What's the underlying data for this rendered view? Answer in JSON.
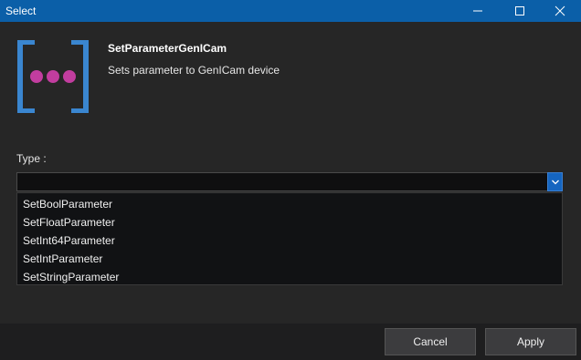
{
  "window": {
    "title": "Select",
    "controls": [
      {
        "name": "minimize-icon"
      },
      {
        "name": "maximize-icon"
      },
      {
        "name": "close-icon"
      }
    ]
  },
  "header": {
    "name": "SetParameterGenICam",
    "description": "Sets parameter to GenICam device",
    "logo_colors": {
      "bracket": "#3a86d0",
      "dots": "#c23d9f"
    }
  },
  "type_field": {
    "label": "Type :",
    "value": "",
    "options": [
      "SetBoolParameter",
      "SetFloatParameter",
      "SetInt64Parameter",
      "SetIntParameter",
      "SetStringParameter"
    ]
  },
  "footer": {
    "cancel_label": "Cancel",
    "apply_label": "Apply"
  },
  "colors": {
    "accent": "#0b5fa8",
    "background": "#262626"
  }
}
